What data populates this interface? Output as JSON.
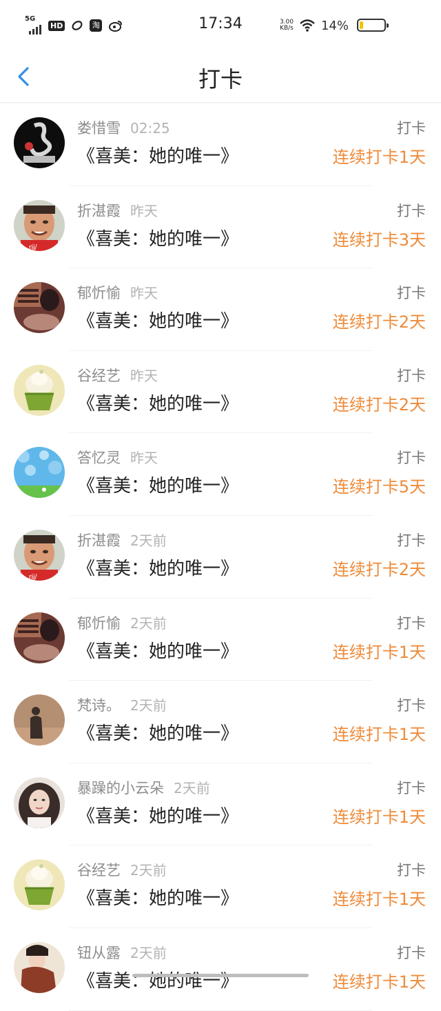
{
  "status_bar": {
    "signal": "5G",
    "hd": "HD",
    "time": "17:34",
    "net_speed_value": "3.00",
    "net_speed_unit": "KB/s",
    "battery": "14%",
    "battery_level": 0.14
  },
  "header": {
    "title": "打卡"
  },
  "items": [
    {
      "name": "娄惜雪",
      "time": "02:25",
      "action": "打卡",
      "book": "《喜美：她的唯一》",
      "streak": "连续打卡1天",
      "avatar": "dragon"
    },
    {
      "name": "折湛霞",
      "time": "昨天",
      "action": "打卡",
      "book": "《喜美：她的唯一》",
      "streak": "连续打卡3天",
      "avatar": "face"
    },
    {
      "name": "郁忻愉",
      "time": "昨天",
      "action": "打卡",
      "book": "《喜美：她的唯一》",
      "streak": "连续打卡2天",
      "avatar": "sepia"
    },
    {
      "name": "谷经艺",
      "time": "昨天",
      "action": "打卡",
      "book": "《喜美：她的唯一》",
      "streak": "连续打卡2天",
      "avatar": "cupcake"
    },
    {
      "name": "答忆灵",
      "time": "昨天",
      "action": "打卡",
      "book": "《喜美：她的唯一》",
      "streak": "连续打卡5天",
      "avatar": "bokeh"
    },
    {
      "name": "折湛霞",
      "time": "2天前",
      "action": "打卡",
      "book": "《喜美：她的唯一》",
      "streak": "连续打卡2天",
      "avatar": "face"
    },
    {
      "name": "郁忻愉",
      "time": "2天前",
      "action": "打卡",
      "book": "《喜美：她的唯一》",
      "streak": "连续打卡1天",
      "avatar": "sepia"
    },
    {
      "name": "梵诗。",
      "time": "2天前",
      "action": "打卡",
      "book": "《喜美：她的唯一》",
      "streak": "连续打卡1天",
      "avatar": "silhouette"
    },
    {
      "name": "暴躁的小云朵",
      "time": "2天前",
      "action": "打卡",
      "book": "《喜美：她的唯一》",
      "streak": "连续打卡1天",
      "avatar": "girl"
    },
    {
      "name": "谷经艺",
      "time": "2天前",
      "action": "打卡",
      "book": "《喜美：她的唯一》",
      "streak": "连续打卡1天",
      "avatar": "cupcake"
    },
    {
      "name": "钮从露",
      "time": "2天前",
      "action": "打卡",
      "book": "《喜美：她的唯一》",
      "streak": "连续打卡1天",
      "avatar": "costume"
    }
  ],
  "colors": {
    "accent_orange": "#ee8b3a",
    "back_blue": "#2f8fe8",
    "name_gray": "#8d8d8d",
    "time_gray": "#b3b3b3"
  }
}
